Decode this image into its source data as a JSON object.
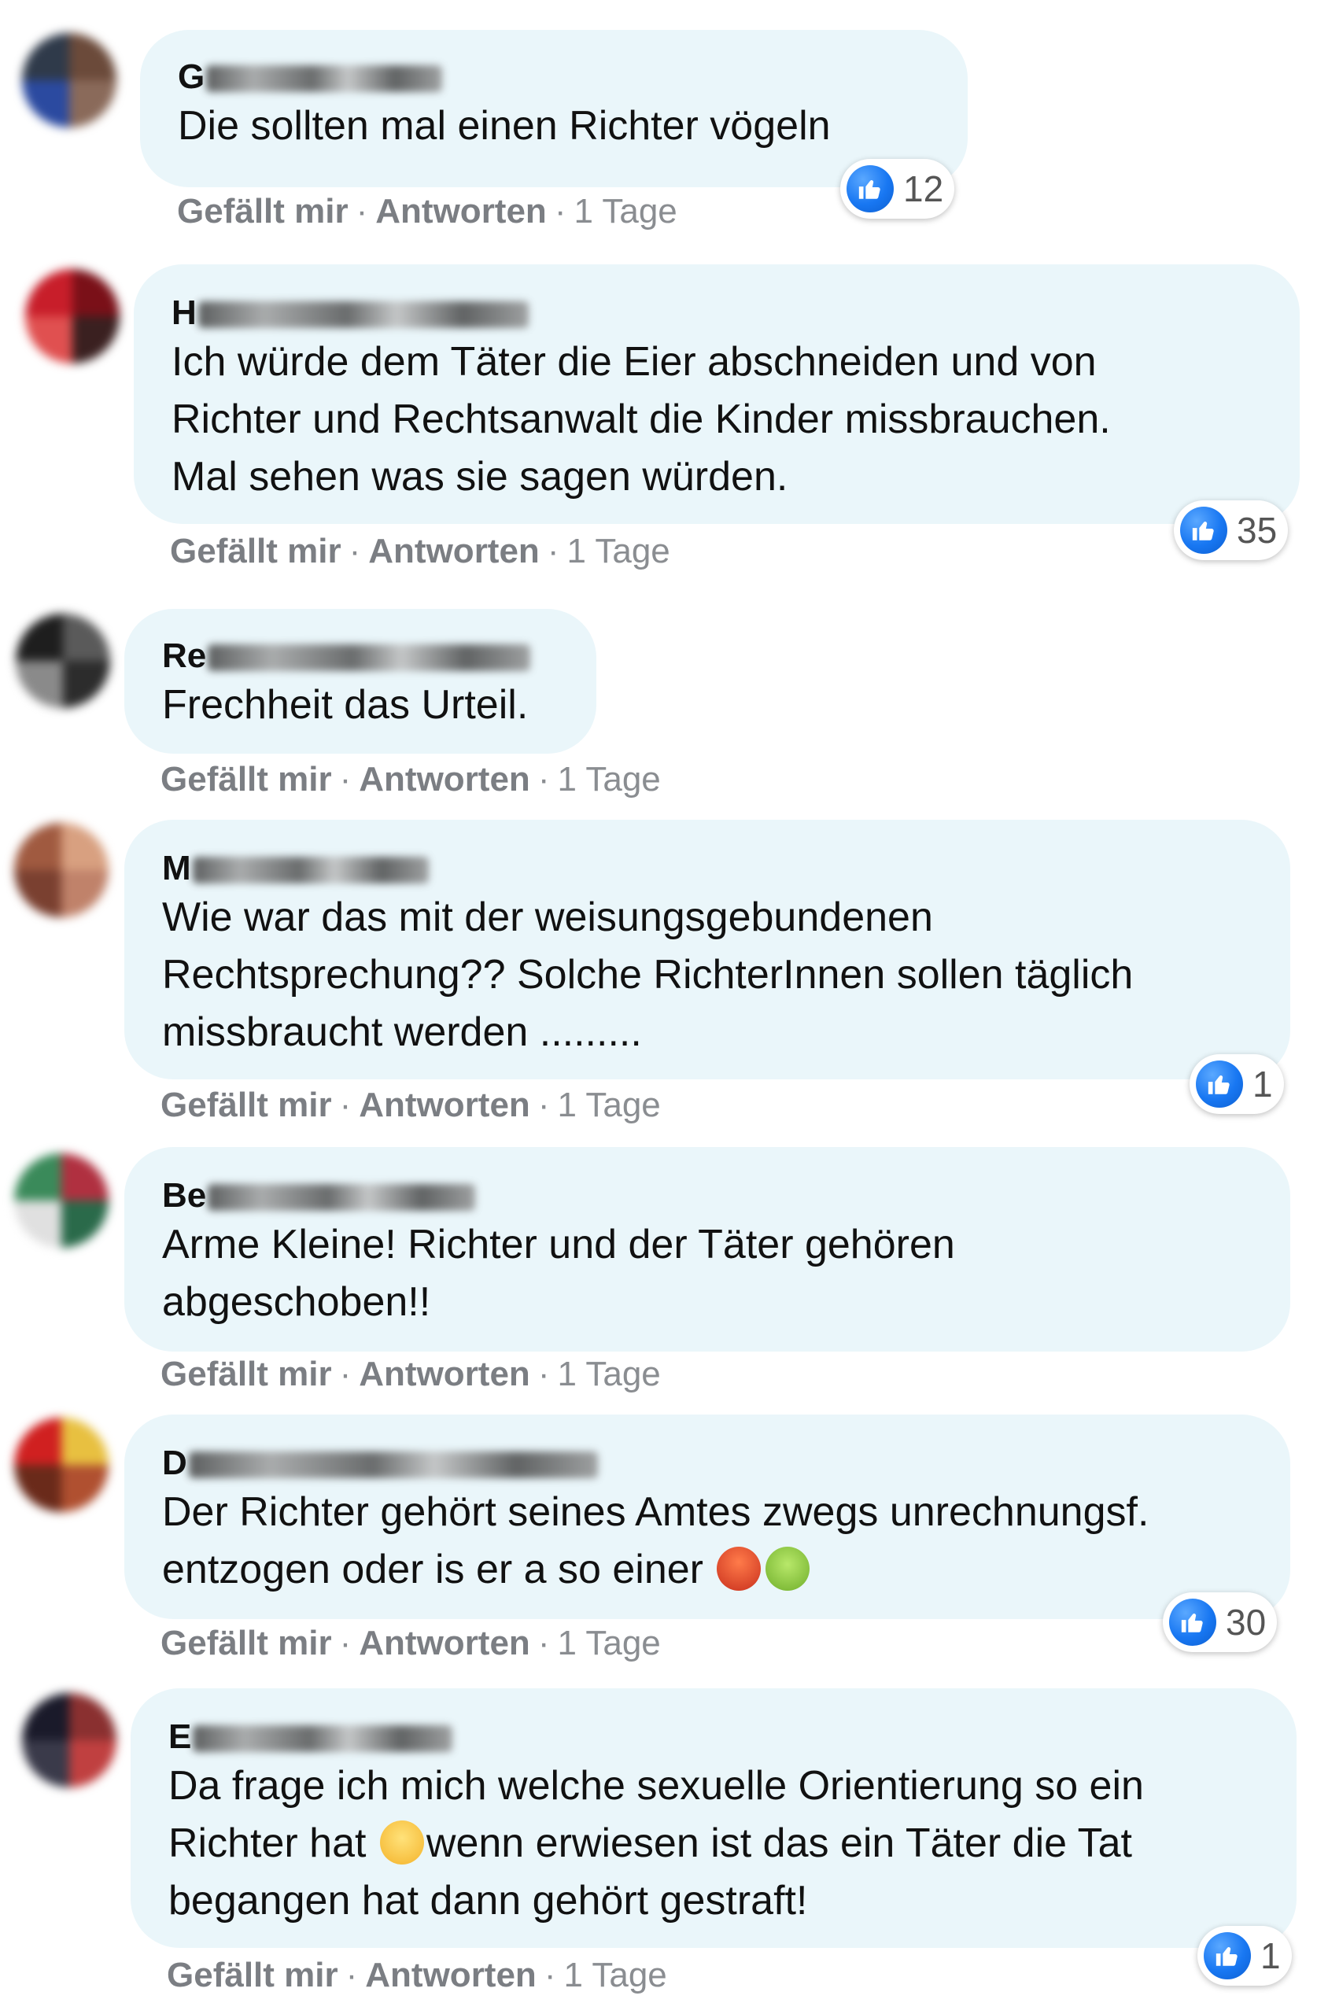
{
  "comments": [
    {
      "author_first": "G",
      "text": "Die sollten mal einen Richter vögeln",
      "reaction_count": "12",
      "avatar_colors": [
        "#2f3a4a",
        "#6b4a3a",
        "#2b4aa0",
        "#8a6a5a"
      ]
    },
    {
      "author_first": "H",
      "text": "Ich würde dem Täter die Eier abschneiden und von\nRichter und Rechtsanwalt die Kinder missbrauchen.\nMal sehen was sie sagen würden.",
      "reaction_count": "35",
      "avatar_colors": [
        "#c81e2a",
        "#7a1018",
        "#e05050",
        "#3a2020"
      ]
    },
    {
      "author_first": "Re",
      "text": "Frechheit das Urteil.",
      "avatar_colors": [
        "#1e1e1e",
        "#5a5a5a",
        "#8a8a8a",
        "#2c2c2c"
      ]
    },
    {
      "author_first": "M",
      "text": "Wie war das mit der weisungsgebundenen\nRechtsprechung?? Solche RichterInnen sollen täglich\nmissbraucht werden .........",
      "reaction_count": "1",
      "avatar_colors": [
        "#a05a40",
        "#d8a080",
        "#7a4030",
        "#c0826a"
      ]
    },
    {
      "author_first": "Be",
      "text": "Arme Kleine! Richter und der Täter gehören\nabgeschoben!!",
      "avatar_colors": [
        "#3a8a5a",
        "#b03040",
        "#e0e0e0",
        "#2a6a4a"
      ]
    },
    {
      "author_first": "D",
      "text_line1": "Der Richter gehört seines Amtes zwegs unrechnungsf.",
      "text_line2": "entzogen oder is er a so einer",
      "reaction_count": "30",
      "avatar_colors": [
        "#d02020",
        "#e8c040",
        "#6a2a1a",
        "#b05030"
      ]
    },
    {
      "author_first": "E",
      "text_line1": "Da frage ich mich welche sexuelle Orientierung so ein",
      "text_line2a": "Richter hat",
      "text_line2b": "wenn erwiesen ist das ein Täter die Tat",
      "text_line3": "begangen hat dann gehört gestraft!",
      "reaction_count": "1",
      "avatar_colors": [
        "#1a1a2a",
        "#8a3030",
        "#3a3a4a",
        "#c04040"
      ]
    }
  ],
  "meta": {
    "like": "Gefällt mir",
    "reply": "Antworten",
    "time": "1 Tage",
    "separator": "·"
  },
  "icons": {
    "reaction": "like-thumbs-up-icon",
    "emoji_d": [
      "rage-face-emoji",
      "nauseated-face-emoji"
    ],
    "emoji_e": "thinking-face-emoji"
  },
  "colors": {
    "bubble": "#eaf6fa",
    "like_blue": "#1877f2",
    "meta_gray": "#7b7e83"
  }
}
